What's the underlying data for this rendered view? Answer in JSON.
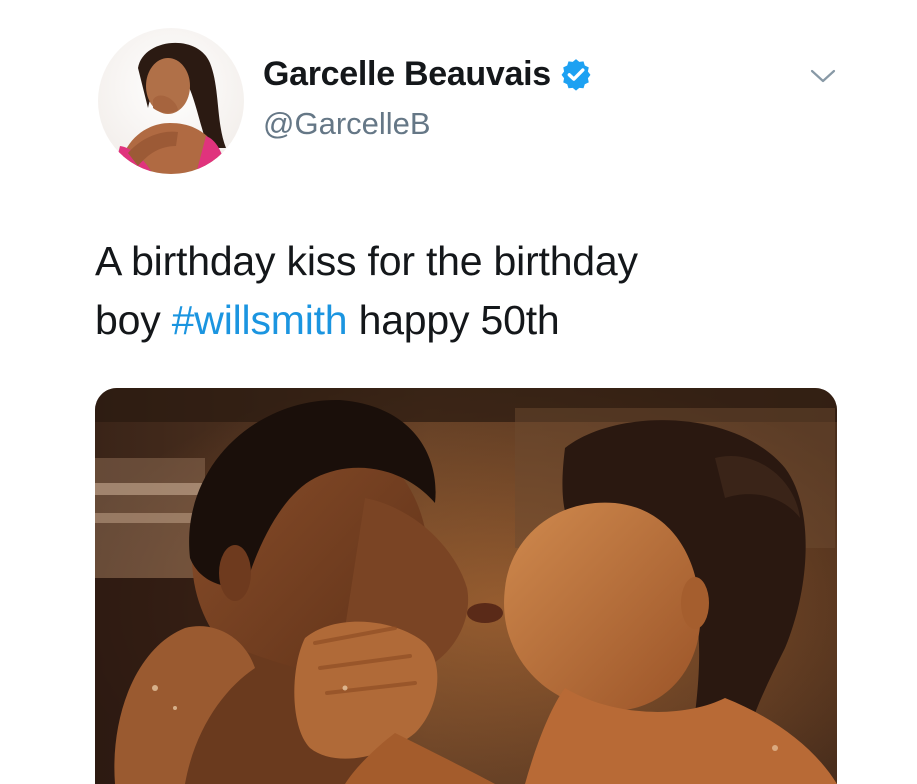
{
  "tweet": {
    "author": {
      "display_name": "Garcelle Beauvais",
      "handle": "@GarcelleB",
      "verified": true,
      "avatar_icon": "profile-photo",
      "verified_icon": "verified-badge-icon"
    },
    "menu_icon": "chevron-down-icon",
    "text_parts": {
      "line1": "A birthday kiss for the birthday",
      "line2_prefix": "boy ",
      "hashtag": "#willsmith",
      "line2_suffix": " happy 50th"
    },
    "media": {
      "kind": "photo"
    }
  },
  "colors": {
    "text": "#14171a",
    "secondary": "#657786",
    "link": "#1b95e0",
    "verified": "#1da1f2",
    "background": "#ffffff"
  }
}
